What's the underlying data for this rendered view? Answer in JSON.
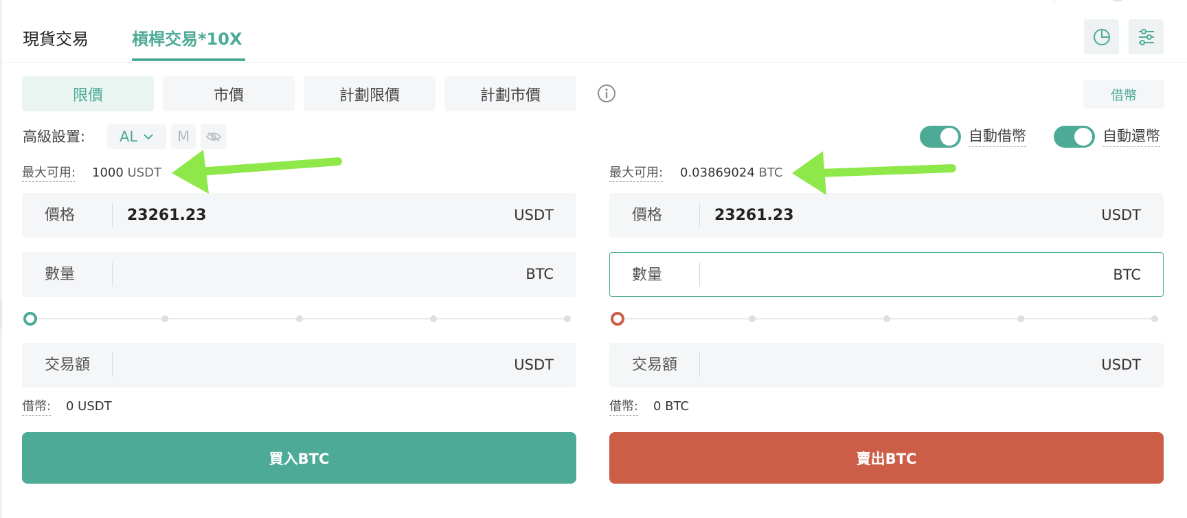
{
  "tabs": {
    "spot": "現貨交易",
    "margin": "槓桿交易*10X"
  },
  "order_types": [
    "限價",
    "市價",
    "計劃限價",
    "計劃市價"
  ],
  "borrow_button": "借幣",
  "advanced": {
    "label": "高級設置:",
    "al_chip": "AL",
    "m_chip": "M"
  },
  "toggles": {
    "auto_borrow": "自動借幣",
    "auto_repay": "自動還幣"
  },
  "buy": {
    "available_label": "最大可用:",
    "available_value": "1000",
    "available_unit": "USDT",
    "price_label": "價格",
    "price_value": "23261.23",
    "price_unit": "USDT",
    "amount_label": "數量",
    "amount_unit": "BTC",
    "total_label": "交易額",
    "total_unit": "USDT",
    "borrowed_label": "借幣:",
    "borrowed_value": "0 USDT",
    "submit": "買入BTC",
    "slider_level": 0
  },
  "sell": {
    "available_label": "最大可用:",
    "available_value": "0.03869024",
    "available_unit": "BTC",
    "price_label": "價格",
    "price_value": "23261.23",
    "price_unit": "USDT",
    "amount_label": "數量",
    "amount_unit": "BTC",
    "total_label": "交易額",
    "total_unit": "USDT",
    "borrowed_label": "借幣:",
    "borrowed_value": "0 BTC",
    "submit": "賣出BTC",
    "slider_level": 0
  },
  "colors": {
    "accent_green": "#4daa96",
    "sell_red": "#cc5e48",
    "annotation_arrow": "#8ee84a"
  },
  "icons": {
    "chart": "pie-chart-icon",
    "settings": "sliders-icon",
    "info": "info-icon",
    "eye": "eye-slash-icon",
    "dropdown": "chevron-down-icon"
  }
}
